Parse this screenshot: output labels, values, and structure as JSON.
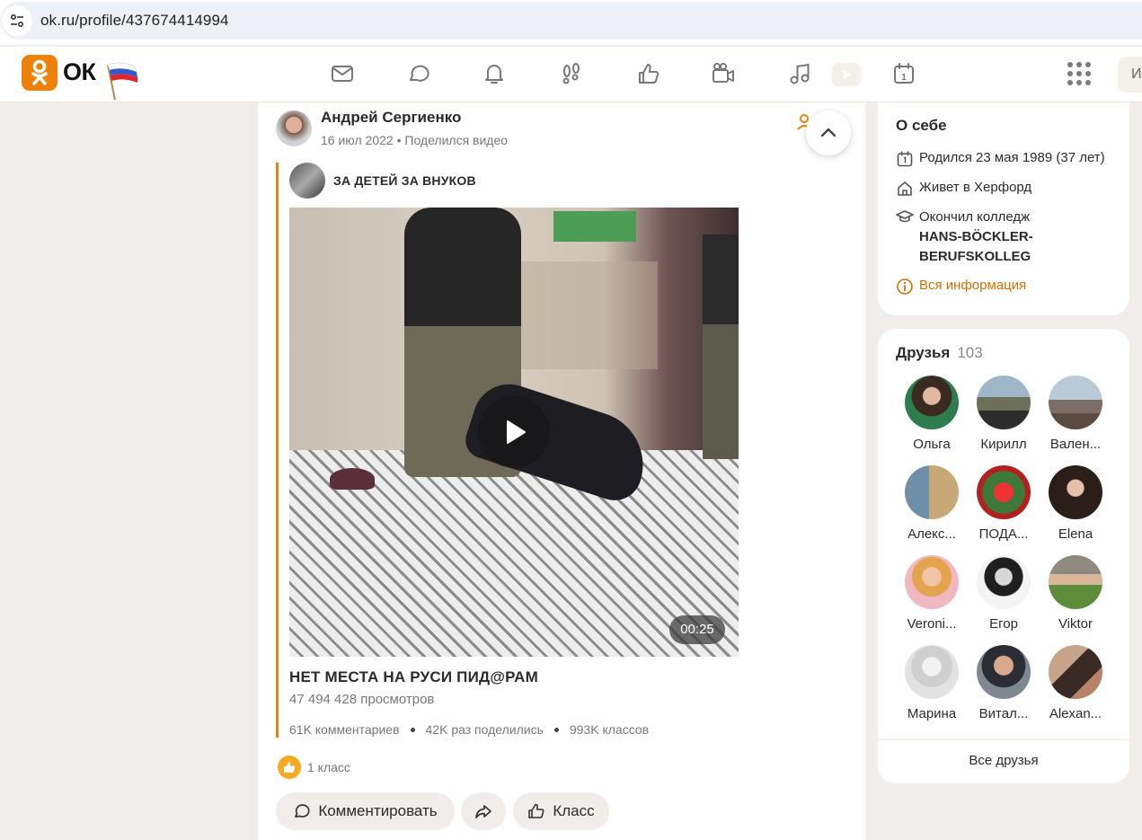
{
  "browser": {
    "url": "ok.ru/profile/437674414994"
  },
  "header": {
    "logo_text": "ОК",
    "nav_icons": [
      "mail-icon",
      "chat-icon",
      "bell-icon",
      "footprints-icon",
      "thumbs-up-icon",
      "camera-icon",
      "music-icon",
      "video-icon",
      "calendar-icon",
      "apps-grid-icon"
    ],
    "calendar_day": "1",
    "search_stub": "И",
    "accent": "#ee8208"
  },
  "post": {
    "author": "Андрей Сергиенко",
    "date": "16 июл 2022",
    "action": "Поделился видео",
    "group": "ЗА ДЕТЕЙ ЗА ВНУКОВ",
    "video": {
      "duration": "00:25",
      "title": "НЕТ МЕСТА НА РУСИ ПИД@РАМ",
      "views": "47 494 428 просмотров",
      "comments": "61K комментариев",
      "shares": "42K раз поделились",
      "likes": "993K классов"
    },
    "like_summary": "1 класс",
    "buttons": {
      "comment": "Комментировать",
      "like": "Класс"
    }
  },
  "about": {
    "title": "О себе",
    "born": "Родился 23 мая 1989 (37 лет)",
    "lives": "Живет в Херфорд",
    "college_prefix": "Окончил колледж",
    "college_name_1": "HANS-BÖCKLER-",
    "college_name_2": "BERUFSKOLLEG",
    "all_info": "Вся информация"
  },
  "friends": {
    "title": "Друзья",
    "count": "103",
    "list": [
      {
        "name": "Ольга"
      },
      {
        "name": "Кирилл"
      },
      {
        "name": "Вален..."
      },
      {
        "name": "Алекс..."
      },
      {
        "name": "ПОДА..."
      },
      {
        "name": "Elena"
      },
      {
        "name": "Veroni..."
      },
      {
        "name": "Егор"
      },
      {
        "name": "Viktor"
      },
      {
        "name": "Марина"
      },
      {
        "name": "Витал..."
      },
      {
        "name": "Alexan..."
      }
    ],
    "all_friends": "Все друзья"
  }
}
